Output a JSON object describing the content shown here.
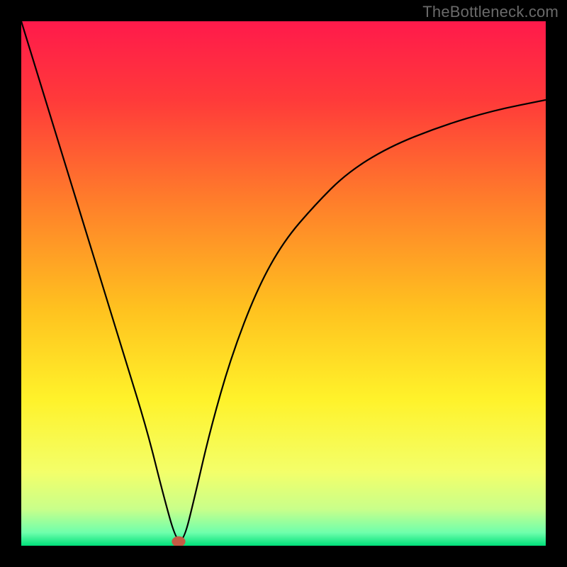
{
  "watermark_text": "TheBottleneck.com",
  "chart_data": {
    "type": "line",
    "title": "",
    "xlabel": "",
    "ylabel": "",
    "xlim": [
      0,
      100
    ],
    "ylim": [
      0,
      100
    ],
    "grid": false,
    "legend": false,
    "background_gradient_stops": [
      {
        "offset": 0.0,
        "color": "#ff1a4b"
      },
      {
        "offset": 0.15,
        "color": "#ff3a3a"
      },
      {
        "offset": 0.35,
        "color": "#ff802a"
      },
      {
        "offset": 0.55,
        "color": "#ffc21f"
      },
      {
        "offset": 0.72,
        "color": "#fff22a"
      },
      {
        "offset": 0.86,
        "color": "#f3ff6a"
      },
      {
        "offset": 0.93,
        "color": "#c9ff8a"
      },
      {
        "offset": 0.975,
        "color": "#6fffac"
      },
      {
        "offset": 1.0,
        "color": "#00e07a"
      }
    ],
    "series": [
      {
        "name": "bottleneck-curve",
        "color": "#000000",
        "x": [
          0,
          4,
          8,
          12,
          16,
          20,
          24,
          27,
          29.5,
          31,
          33,
          36,
          40,
          45,
          50,
          56,
          62,
          70,
          80,
          90,
          100
        ],
        "values": [
          100,
          87,
          74,
          61,
          48,
          35,
          22,
          10,
          1,
          1,
          9,
          22,
          36,
          49,
          58,
          65,
          71,
          76,
          80,
          83,
          85
        ]
      }
    ],
    "marker": {
      "x": 30,
      "y": 0.8,
      "rx": 1.3,
      "ry": 1.0,
      "color": "#c55a44"
    }
  }
}
